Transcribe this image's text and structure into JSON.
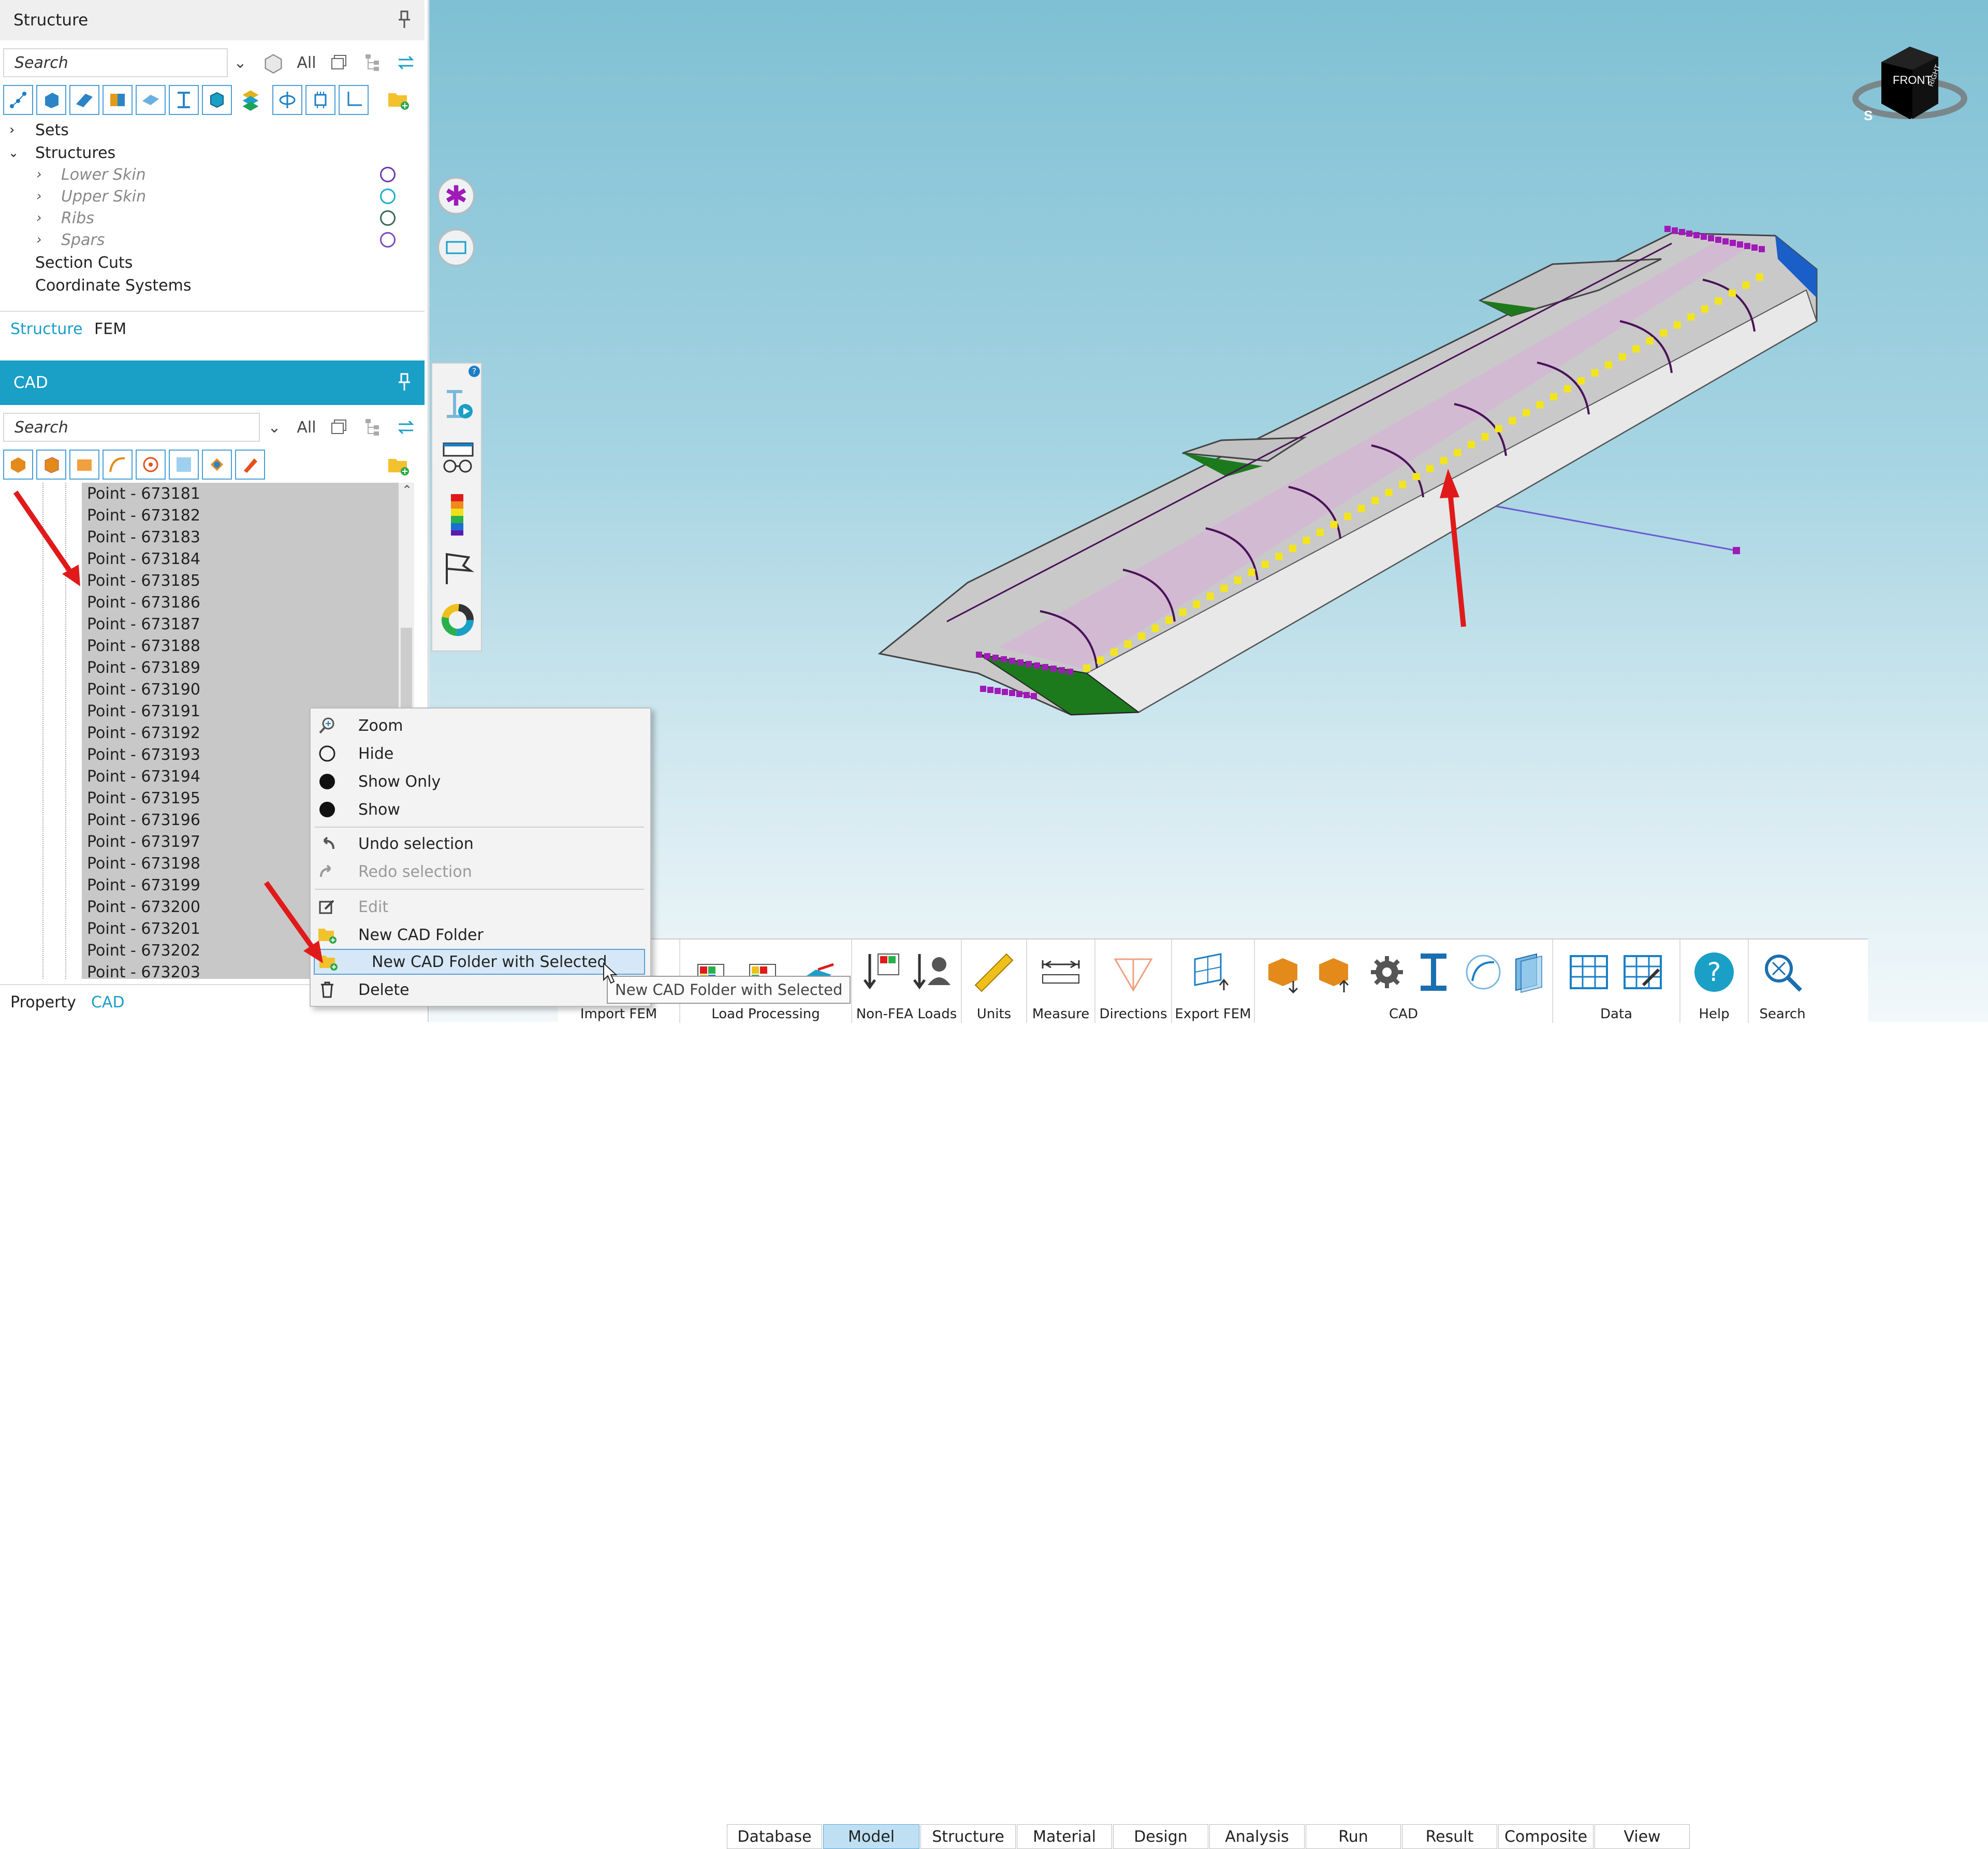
{
  "structure_panel": {
    "title": "Structure",
    "search_placeholder": "Search",
    "filter_all": "All",
    "tree": {
      "sets": "Sets",
      "structures": "Structures",
      "children": [
        "Lower Skin",
        "Upper Skin",
        "Ribs",
        "Spars"
      ],
      "section_cuts": "Section Cuts",
      "coordinate_systems": "Coordinate Systems"
    },
    "tabs": [
      "Structure",
      "FEM"
    ]
  },
  "cad_panel": {
    "title": "CAD",
    "search_placeholder": "Search",
    "filter_all": "All",
    "points": [
      "Point - 673181",
      "Point - 673182",
      "Point - 673183",
      "Point - 673184",
      "Point - 673185",
      "Point - 673186",
      "Point - 673187",
      "Point - 673188",
      "Point - 673189",
      "Point - 673190",
      "Point - 673191",
      "Point - 673192",
      "Point - 673193",
      "Point - 673194",
      "Point - 673195",
      "Point - 673196",
      "Point - 673197",
      "Point - 673198",
      "Point - 673199",
      "Point - 673200",
      "Point - 673201",
      "Point - 673202",
      "Point - 673203"
    ],
    "bottom_tabs": [
      "Property",
      "CAD"
    ]
  },
  "context_menu": {
    "items": [
      "Zoom",
      "Hide",
      "Show Only",
      "Show",
      "Undo selection",
      "Redo selection",
      "Edit",
      "New CAD Folder",
      "New CAD Folder with Selected",
      "Delete"
    ],
    "tooltip": "New CAD Folder with Selected"
  },
  "view_cube": {
    "front": "FRONT",
    "right": "RIGHT",
    "south": "S"
  },
  "ribbon": {
    "tabs": [
      "Database",
      "Model",
      "Structure",
      "Material",
      "Design",
      "Analysis",
      "Run",
      "Result",
      "Composite",
      "View"
    ],
    "active_tab": "Model",
    "groups": [
      "Load Processing",
      "Non-FEA Loads",
      "Units",
      "Measure",
      "Directions",
      "Export FEM",
      "CAD",
      "Data",
      "Help",
      "Search"
    ],
    "partial_group": "Import FEM"
  },
  "colors": {
    "accent": "#1a9fc7",
    "selection_yellow": "#f3e51c",
    "point_purple": "#a01ab8",
    "rib_purple": "#4a1258",
    "skin_green": "#1c7a1c"
  }
}
